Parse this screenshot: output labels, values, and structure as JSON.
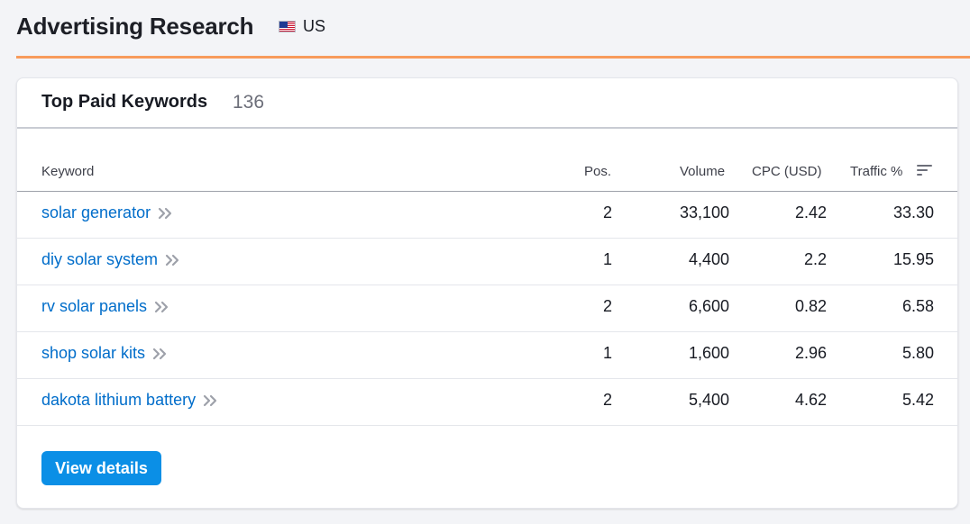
{
  "header": {
    "title": "Advertising Research",
    "country": "US",
    "flag_icon": "us-flag-icon"
  },
  "colors": {
    "accent": "#f89b5c",
    "link": "#006dca",
    "button": "#0b8fe6"
  },
  "card": {
    "title": "Top Paid Keywords",
    "count": "136",
    "columns": {
      "keyword": "Keyword",
      "pos": "Pos.",
      "volume": "Volume",
      "cpc": "CPC (USD)",
      "traffic": "Traffic %"
    },
    "rows": [
      {
        "keyword": "solar generator",
        "pos": "2",
        "volume": "33,100",
        "cpc": "2.42",
        "traffic": "33.30"
      },
      {
        "keyword": "diy solar system",
        "pos": "1",
        "volume": "4,400",
        "cpc": "2.2",
        "traffic": "15.95"
      },
      {
        "keyword": "rv solar panels",
        "pos": "2",
        "volume": "6,600",
        "cpc": "0.82",
        "traffic": "6.58"
      },
      {
        "keyword": "shop solar kits",
        "pos": "1",
        "volume": "1,600",
        "cpc": "2.96",
        "traffic": "5.80"
      },
      {
        "keyword": "dakota lithium battery",
        "pos": "2",
        "volume": "5,400",
        "cpc": "4.62",
        "traffic": "5.42"
      }
    ],
    "button_label": "View details"
  }
}
